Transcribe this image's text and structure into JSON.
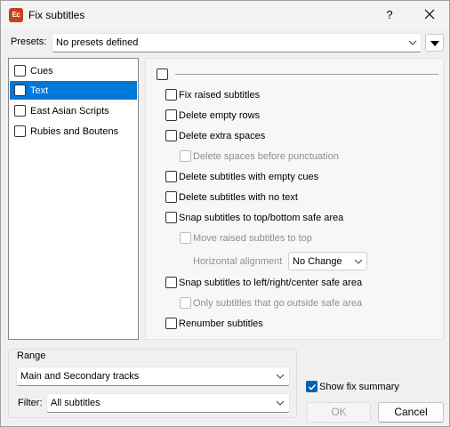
{
  "window": {
    "title": "Fix subtitles",
    "app_icon_text": "Ec",
    "help_label": "?"
  },
  "presets": {
    "label": "Presets:",
    "value": "No presets defined"
  },
  "categories": [
    {
      "label": "Cues",
      "checked": false,
      "selected": false
    },
    {
      "label": "Text",
      "checked": false,
      "selected": true
    },
    {
      "label": "East Asian Scripts",
      "checked": false,
      "selected": false
    },
    {
      "label": "Rubies and Boutens",
      "checked": false,
      "selected": false
    }
  ],
  "options": {
    "fix_raised": "Fix raised subtitles",
    "delete_empty_rows": "Delete empty rows",
    "delete_extra_spaces": "Delete extra spaces",
    "delete_spaces_before_punct": "Delete spaces before punctuation",
    "delete_empty_cues": "Delete subtitles with empty cues",
    "delete_no_text": "Delete subtitles with no text",
    "snap_top_bottom": "Snap subtitles to top/bottom safe area",
    "move_raised_top": "Move raised subtitles to top",
    "horizontal_alignment_label": "Horizontal alignment",
    "horizontal_alignment_value": "No Change",
    "snap_left_right": "Snap subtitles to left/right/center safe area",
    "only_outside_safe": "Only subtitles that go outside safe area",
    "renumber": "Renumber subtitles"
  },
  "range": {
    "title": "Range",
    "tracks_value": "Main and Secondary tracks",
    "filter_label": "Filter:",
    "filter_value": "All subtitles"
  },
  "summary": {
    "show_fix_summary": "Show fix summary",
    "checked": true
  },
  "buttons": {
    "ok": "OK",
    "cancel": "Cancel"
  },
  "colors": {
    "accent": "#0078d7",
    "app_icon": "#c8401c"
  }
}
